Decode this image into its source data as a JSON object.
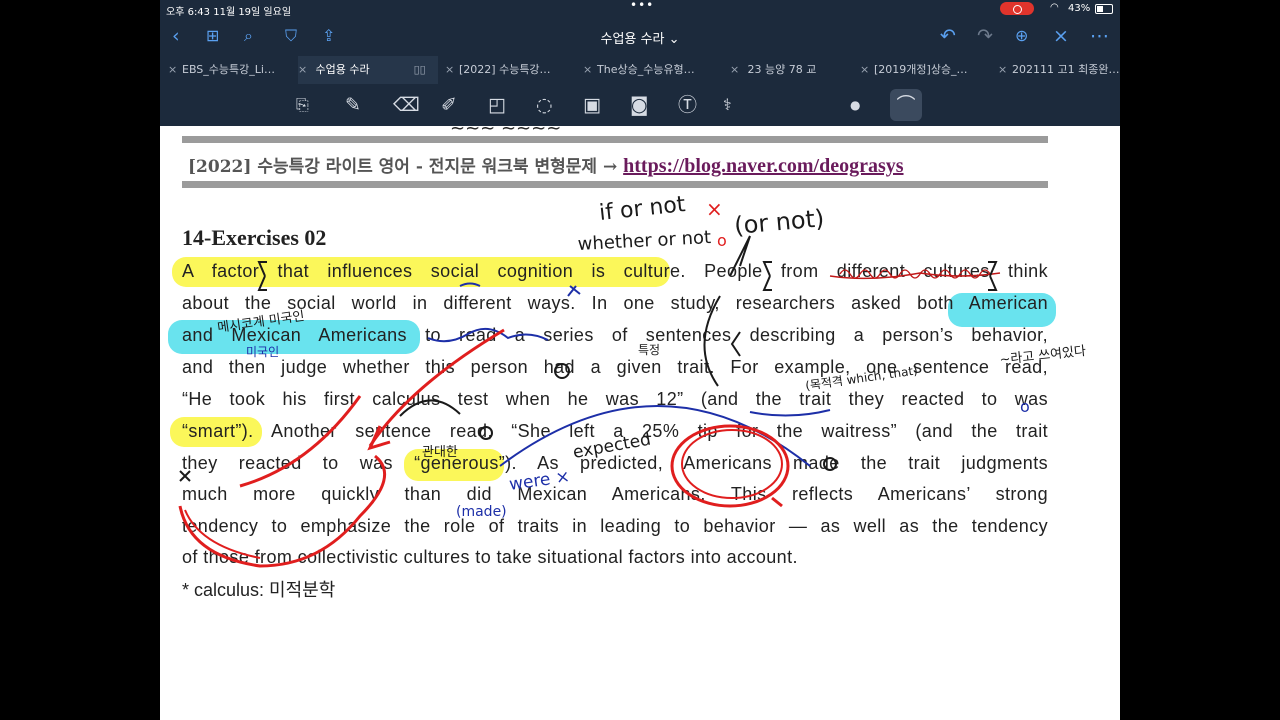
{
  "status": {
    "time": "오후 6:43   11월 19일 일요일",
    "battery": "43%"
  },
  "nav": {
    "title": "수업용 수라 ⌄"
  },
  "tabs": [
    {
      "label": "EBS_수능특강_Li…"
    },
    {
      "label": "수업용 수라"
    },
    {
      "label": "[2022] 수능특강…"
    },
    {
      "label": "The상승_수능유형…"
    },
    {
      "label": "23 능양 78 교"
    },
    {
      "label": "[2019개정]상승_…"
    },
    {
      "label": "202111 고1 최종완…"
    }
  ],
  "document": {
    "header_text": "[2022] 수능특강 라이트 영어  - 전지문 워크북 변형문제 → ",
    "header_link": "https://blog.naver.com/deograsys",
    "exercise_title": "14-Exercises 02",
    "lines": [
      "A factor that influences social cognition is culture. People from different cultures think",
      "about the social world in different ways. In one study, researchers asked both American",
      "and Mexican Americans to read a series of sentences describing a person’s behavior,",
      "and then judge whether this person had a given trait. For example, one sentence read,",
      "“He took his first calculus test when he was 12” (and the trait they reacted to was",
      "“smart”). Another sentence read, “She left a 25% tip for the waitress” (and the trait",
      "they reacted to was “generous”). As predicted, Americans made the trait judgments",
      "much more quickly than did Mexican Americans. This reflects Americans’ strong",
      "tendency to emphasize the role of traits in leading to behavior — as well as the tendency",
      "of those from collectivistic cultures to take situational factors into account."
    ],
    "note": "* calculus: 미적분학"
  },
  "annotations": {
    "if_or_not": "if or not",
    "x_mark": "×",
    "whether_or_not": "whether or not",
    "o_mark": "o",
    "or_not": "(or not)",
    "korean_1": "메시코계 미국인",
    "korean_2": "미국인",
    "korean_3": "특정",
    "korean_4": "~라고 쓰여있다",
    "korean_5": "관대한",
    "relative": "(목적격 which, that)",
    "expected": "expected",
    "were_x": "were ×",
    "made": "(made)",
    "o_small": "o"
  },
  "colors": {
    "yellow_highlight": "#fbf75a",
    "cyan_highlight": "#69e3ee",
    "red_ink": "#e01e1e",
    "blue_ink": "#1d2fa8"
  }
}
